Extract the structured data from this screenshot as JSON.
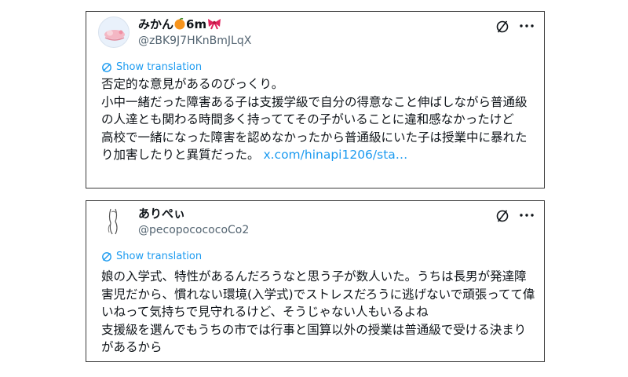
{
  "tweets": [
    {
      "display_name": "みかん",
      "name_suffix": "6m",
      "handle": "@zBK9J7HKnBmJLqX",
      "translate_label": "Show translation",
      "lines": [
        "否定的な意見があるのびっくり。",
        "小中一緒だった障害ある子は支援学級で自分の得意なこと伸ばしながら普通級の人達とも関わる時間多く持っててその子がいることに違和感なかったけど",
        "高校で一緒になった障害を認めなかったから普通級にいた子は授業中に暴れたり加害したりと異質だった。"
      ],
      "link_text": "x.com/hinapi1206/sta…",
      "icons": {
        "avatar": "avatar",
        "mute": "mute-icon",
        "more": "more-icon",
        "translate": "translate-icon"
      }
    },
    {
      "display_name": "ありぺぃ",
      "handle": "@pecopocococoCo2",
      "translate_label": "Show translation",
      "lines": [
        "娘の入学式、特性があるんだろうなと思う子が数人いた。うちは長男が発達障害児だから、慣れない環境(入学式)でストレスだろうに逃げないで頑張ってて偉いねって気持ちで見守れるけど、そうじゃない人もいるよね",
        "支援級を選んでもうちの市では行事と国算以外の授業は普通級で受ける決まりがあるから"
      ],
      "icons": {
        "avatar": "avatar",
        "mute": "mute-icon",
        "more": "more-icon",
        "translate": "translate-icon"
      }
    }
  ],
  "colors": {
    "link": "#1d9bf0",
    "text": "#0f1419",
    "muted": "#536471",
    "border": "#3a3a3a"
  }
}
